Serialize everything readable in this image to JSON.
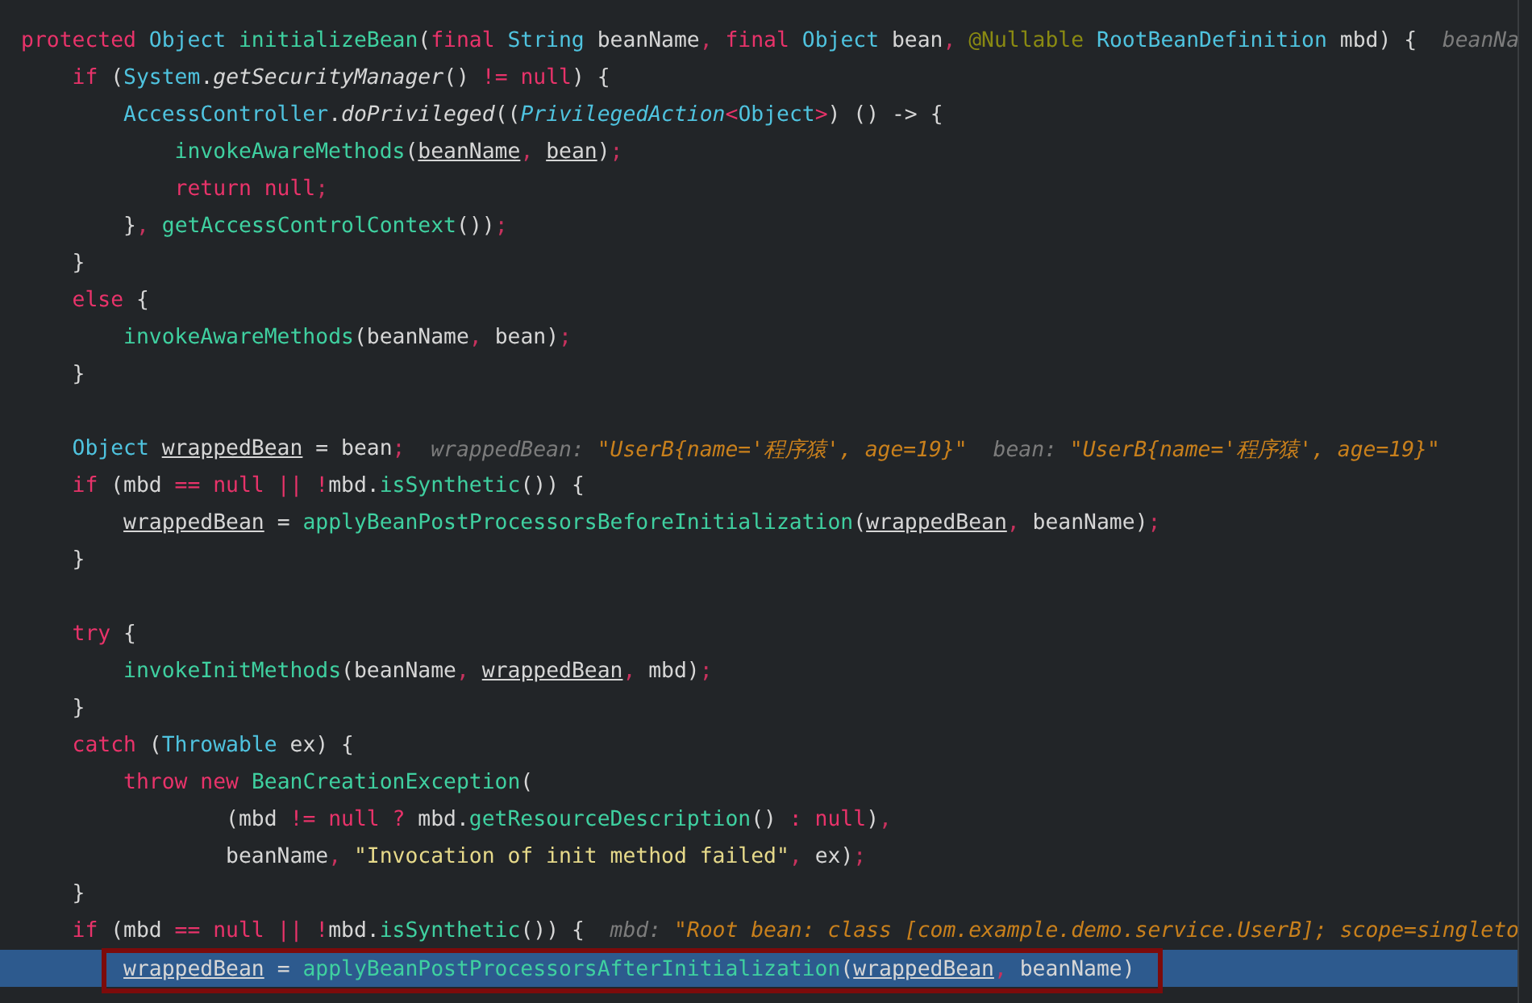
{
  "lines": [
    {
      "highlighted": false,
      "boxed": false,
      "tokens": [
        {
          "text": "protected ",
          "kind": "keyword"
        },
        {
          "text": "Object ",
          "kind": "type"
        },
        {
          "text": "initializeBean",
          "kind": "method"
        },
        {
          "text": "(",
          "kind": "plain"
        },
        {
          "text": "final ",
          "kind": "keyword"
        },
        {
          "text": "String ",
          "kind": "type"
        },
        {
          "text": "beanName",
          "kind": "plain"
        },
        {
          "text": ", ",
          "kind": "separator"
        },
        {
          "text": "final ",
          "kind": "keyword"
        },
        {
          "text": "Object ",
          "kind": "type"
        },
        {
          "text": "bean",
          "kind": "plain"
        },
        {
          "text": ", ",
          "kind": "separator"
        },
        {
          "text": "@Nullable ",
          "kind": "annotation"
        },
        {
          "text": "RootBeanDefinition ",
          "kind": "type"
        },
        {
          "text": "mbd) {",
          "kind": "plain"
        }
      ],
      "hints": [
        {
          "label": "beanNa"
        }
      ]
    },
    {
      "highlighted": false,
      "boxed": false,
      "tokens": [
        {
          "text": "    if ",
          "kind": "keyword"
        },
        {
          "text": "(",
          "kind": "plain"
        },
        {
          "text": "System",
          "kind": "type"
        },
        {
          "text": ".",
          "kind": "plain"
        },
        {
          "text": "getSecurityManager",
          "kind": "static-method"
        },
        {
          "text": "() ",
          "kind": "plain"
        },
        {
          "text": "!= null",
          "kind": "keyword"
        },
        {
          "text": ") {",
          "kind": "plain"
        }
      ]
    },
    {
      "highlighted": false,
      "boxed": false,
      "tokens": [
        {
          "text": "        AccessController",
          "kind": "type"
        },
        {
          "text": ".",
          "kind": "plain"
        },
        {
          "text": "doPrivileged",
          "kind": "static-method"
        },
        {
          "text": "((",
          "kind": "plain"
        },
        {
          "text": "PrivilegedAction",
          "kind": "type-italic"
        },
        {
          "text": "<",
          "kind": "keyword"
        },
        {
          "text": "Object",
          "kind": "type"
        },
        {
          "text": ">",
          "kind": "keyword"
        },
        {
          "text": ") () -> {",
          "kind": "plain"
        }
      ]
    },
    {
      "highlighted": false,
      "boxed": false,
      "tokens": [
        {
          "text": "            invokeAwareMethods",
          "kind": "method"
        },
        {
          "text": "(",
          "kind": "plain"
        },
        {
          "text": "beanName",
          "kind": "param-ref"
        },
        {
          "text": ", ",
          "kind": "separator"
        },
        {
          "text": "bean",
          "kind": "param-ref"
        },
        {
          "text": ")",
          "kind": "plain"
        },
        {
          "text": ";",
          "kind": "separator"
        }
      ]
    },
    {
      "highlighted": false,
      "boxed": false,
      "tokens": [
        {
          "text": "            return null",
          "kind": "keyword"
        },
        {
          "text": ";",
          "kind": "separator"
        }
      ]
    },
    {
      "highlighted": false,
      "boxed": false,
      "tokens": [
        {
          "text": "        }",
          "kind": "plain"
        },
        {
          "text": ", ",
          "kind": "separator"
        },
        {
          "text": "getAccessControlContext",
          "kind": "method"
        },
        {
          "text": "())",
          "kind": "plain"
        },
        {
          "text": ";",
          "kind": "separator"
        }
      ]
    },
    {
      "highlighted": false,
      "boxed": false,
      "tokens": [
        {
          "text": "    }",
          "kind": "plain"
        }
      ]
    },
    {
      "highlighted": false,
      "boxed": false,
      "tokens": [
        {
          "text": "    else ",
          "kind": "keyword"
        },
        {
          "text": "{",
          "kind": "plain"
        }
      ]
    },
    {
      "highlighted": false,
      "boxed": false,
      "tokens": [
        {
          "text": "        invokeAwareMethods",
          "kind": "method"
        },
        {
          "text": "(beanName",
          "kind": "plain"
        },
        {
          "text": ", ",
          "kind": "separator"
        },
        {
          "text": "bean)",
          "kind": "plain"
        },
        {
          "text": ";",
          "kind": "separator"
        }
      ]
    },
    {
      "highlighted": false,
      "boxed": false,
      "tokens": [
        {
          "text": "    }",
          "kind": "plain"
        }
      ]
    },
    {
      "highlighted": false
    },
    {
      "highlighted": false,
      "boxed": false,
      "tokens": [
        {
          "text": "    Object ",
          "kind": "type"
        },
        {
          "text": "wrappedBean",
          "kind": "param-ref"
        },
        {
          "text": " = bean",
          "kind": "plain"
        },
        {
          "text": ";",
          "kind": "separator"
        }
      ],
      "hints": [
        {
          "label": "wrappedBean:",
          "value": "\"UserB{name='程序猿', age=19}\""
        },
        {
          "label": "bean:",
          "value": "\"UserB{name='程序猿', age=19}\""
        }
      ]
    },
    {
      "highlighted": false,
      "boxed": false,
      "tokens": [
        {
          "text": "    if ",
          "kind": "keyword"
        },
        {
          "text": "(mbd ",
          "kind": "plain"
        },
        {
          "text": "== null || !",
          "kind": "keyword"
        },
        {
          "text": "mbd.",
          "kind": "plain"
        },
        {
          "text": "isSynthetic",
          "kind": "method"
        },
        {
          "text": "()) {",
          "kind": "plain"
        }
      ]
    },
    {
      "highlighted": false,
      "boxed": false,
      "tokens": [
        {
          "text": "        wrappedBean",
          "kind": "param-ref"
        },
        {
          "text": " = ",
          "kind": "plain"
        },
        {
          "text": "applyBeanPostProcessorsBeforeInitialization",
          "kind": "method"
        },
        {
          "text": "(",
          "kind": "plain"
        },
        {
          "text": "wrappedBean",
          "kind": "param-ref"
        },
        {
          "text": ", ",
          "kind": "separator"
        },
        {
          "text": "beanName)",
          "kind": "plain"
        },
        {
          "text": ";",
          "kind": "separator"
        }
      ]
    },
    {
      "highlighted": false,
      "boxed": false,
      "tokens": [
        {
          "text": "    }",
          "kind": "plain"
        }
      ]
    },
    {
      "highlighted": false
    },
    {
      "highlighted": false,
      "boxed": false,
      "tokens": [
        {
          "text": "    try ",
          "kind": "keyword"
        },
        {
          "text": "{",
          "kind": "plain"
        }
      ]
    },
    {
      "highlighted": false,
      "boxed": false,
      "tokens": [
        {
          "text": "        invokeInitMethods",
          "kind": "method"
        },
        {
          "text": "(beanName",
          "kind": "plain"
        },
        {
          "text": ", ",
          "kind": "separator"
        },
        {
          "text": "wrappedBean",
          "kind": "param-ref"
        },
        {
          "text": ", ",
          "kind": "separator"
        },
        {
          "text": "mbd)",
          "kind": "plain"
        },
        {
          "text": ";",
          "kind": "separator"
        }
      ]
    },
    {
      "highlighted": false,
      "boxed": false,
      "tokens": [
        {
          "text": "    }",
          "kind": "plain"
        }
      ]
    },
    {
      "highlighted": false,
      "boxed": false,
      "tokens": [
        {
          "text": "    catch ",
          "kind": "keyword"
        },
        {
          "text": "(",
          "kind": "plain"
        },
        {
          "text": "Throwable ",
          "kind": "type"
        },
        {
          "text": "ex) {",
          "kind": "plain"
        }
      ]
    },
    {
      "highlighted": false,
      "boxed": false,
      "tokens": [
        {
          "text": "        throw new ",
          "kind": "keyword"
        },
        {
          "text": "BeanCreationException",
          "kind": "method"
        },
        {
          "text": "(",
          "kind": "plain"
        }
      ]
    },
    {
      "highlighted": false,
      "boxed": false,
      "tokens": [
        {
          "text": "                (mbd ",
          "kind": "plain"
        },
        {
          "text": "!= null ? ",
          "kind": "keyword"
        },
        {
          "text": "mbd.",
          "kind": "plain"
        },
        {
          "text": "getResourceDescription",
          "kind": "method"
        },
        {
          "text": "() ",
          "kind": "plain"
        },
        {
          "text": ": null",
          "kind": "keyword"
        },
        {
          "text": ")",
          "kind": "plain"
        },
        {
          "text": ",",
          "kind": "separator"
        }
      ]
    },
    {
      "highlighted": false,
      "boxed": false,
      "tokens": [
        {
          "text": "                beanName",
          "kind": "plain"
        },
        {
          "text": ", ",
          "kind": "separator"
        },
        {
          "text": "\"Invocation of init method failed\"",
          "kind": "string"
        },
        {
          "text": ", ",
          "kind": "separator"
        },
        {
          "text": "ex)",
          "kind": "plain"
        },
        {
          "text": ";",
          "kind": "separator"
        }
      ]
    },
    {
      "highlighted": false,
      "boxed": false,
      "tokens": [
        {
          "text": "    }",
          "kind": "plain"
        }
      ]
    },
    {
      "highlighted": false,
      "boxed": false,
      "tokens": [
        {
          "text": "    if ",
          "kind": "keyword"
        },
        {
          "text": "(mbd ",
          "kind": "plain"
        },
        {
          "text": "== null || !",
          "kind": "keyword"
        },
        {
          "text": "mbd.",
          "kind": "plain"
        },
        {
          "text": "isSynthetic",
          "kind": "method"
        },
        {
          "text": "()) {",
          "kind": "plain"
        }
      ],
      "hints": [
        {
          "label": "mbd:",
          "value": "\"Root bean: class [com.example.demo.service.UserB]; scope=singleto"
        }
      ]
    },
    {
      "highlighted": true,
      "boxed": true,
      "tokens": [
        {
          "text": "        wrappedBean",
          "kind": "param-ref"
        },
        {
          "text": " = ",
          "kind": "plain"
        },
        {
          "text": "applyBeanPostProcessorsAfterInitialization",
          "kind": "method"
        },
        {
          "text": "(",
          "kind": "plain"
        },
        {
          "text": "wrappedBean",
          "kind": "param-ref"
        },
        {
          "text": ", ",
          "kind": "separator"
        },
        {
          "text": "beanName)",
          "kind": "plain"
        }
      ]
    }
  ]
}
